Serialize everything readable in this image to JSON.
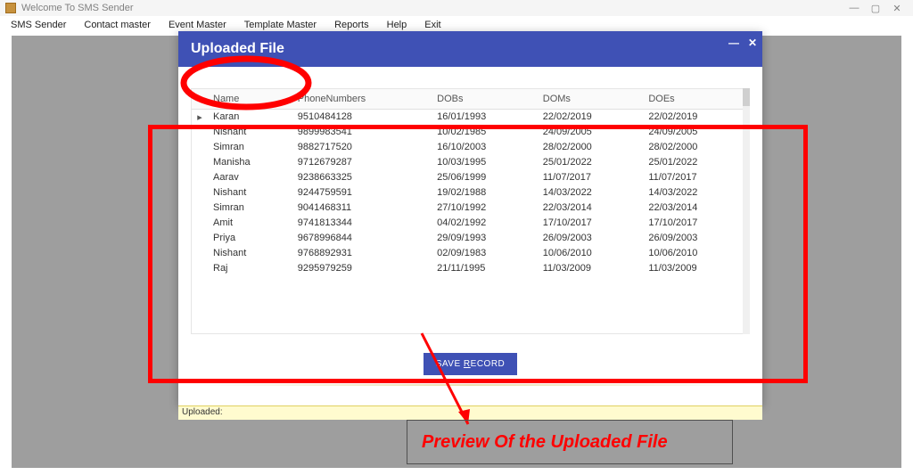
{
  "window": {
    "title": "Welcome To SMS Sender",
    "menu": [
      "SMS Sender",
      "Contact master",
      "Event Master",
      "Template Master",
      "Reports",
      "Help",
      "Exit"
    ]
  },
  "modal": {
    "title": "Uploaded File",
    "columns": [
      "Name",
      "PhoneNumbers",
      "DOBs",
      "DOMs",
      "DOEs"
    ],
    "rows": [
      {
        "mark": "▸",
        "c": [
          "Karan",
          "9510484128",
          "16/01/1993",
          "22/02/2019",
          "22/02/2019"
        ]
      },
      {
        "mark": "",
        "c": [
          "Nishant",
          "9899983541",
          "10/02/1985",
          "24/09/2005",
          "24/09/2005"
        ]
      },
      {
        "mark": "",
        "c": [
          "Simran",
          "9882717520",
          "16/10/2003",
          "28/02/2000",
          "28/02/2000"
        ]
      },
      {
        "mark": "",
        "c": [
          "Manisha",
          "9712679287",
          "10/03/1995",
          "25/01/2022",
          "25/01/2022"
        ]
      },
      {
        "mark": "",
        "c": [
          "Aarav",
          "9238663325",
          "25/06/1999",
          "11/07/2017",
          "11/07/2017"
        ]
      },
      {
        "mark": "",
        "c": [
          "Nishant",
          "9244759591",
          "19/02/1988",
          "14/03/2022",
          "14/03/2022"
        ]
      },
      {
        "mark": "",
        "c": [
          "Simran",
          "9041468311",
          "27/10/1992",
          "22/03/2014",
          "22/03/2014"
        ]
      },
      {
        "mark": "",
        "c": [
          "Amit",
          "9741813344",
          "04/02/1992",
          "17/10/2017",
          "17/10/2017"
        ]
      },
      {
        "mark": "",
        "c": [
          "Priya",
          "9678996844",
          "29/09/1993",
          "26/09/2003",
          "26/09/2003"
        ]
      },
      {
        "mark": "",
        "c": [
          "Nishant",
          "9768892931",
          "02/09/1983",
          "10/06/2010",
          "10/06/2010"
        ]
      },
      {
        "mark": "",
        "c": [
          "Raj",
          "9295979259",
          "21/11/1995",
          "11/03/2009",
          "11/03/2009"
        ]
      }
    ],
    "save_label_pre": "SAVE ",
    "save_label_ul": "R",
    "save_label_post": "ECORD"
  },
  "status": {
    "label": "Uploaded:"
  },
  "annotation": {
    "caption": "Preview Of the Uploaded File"
  }
}
